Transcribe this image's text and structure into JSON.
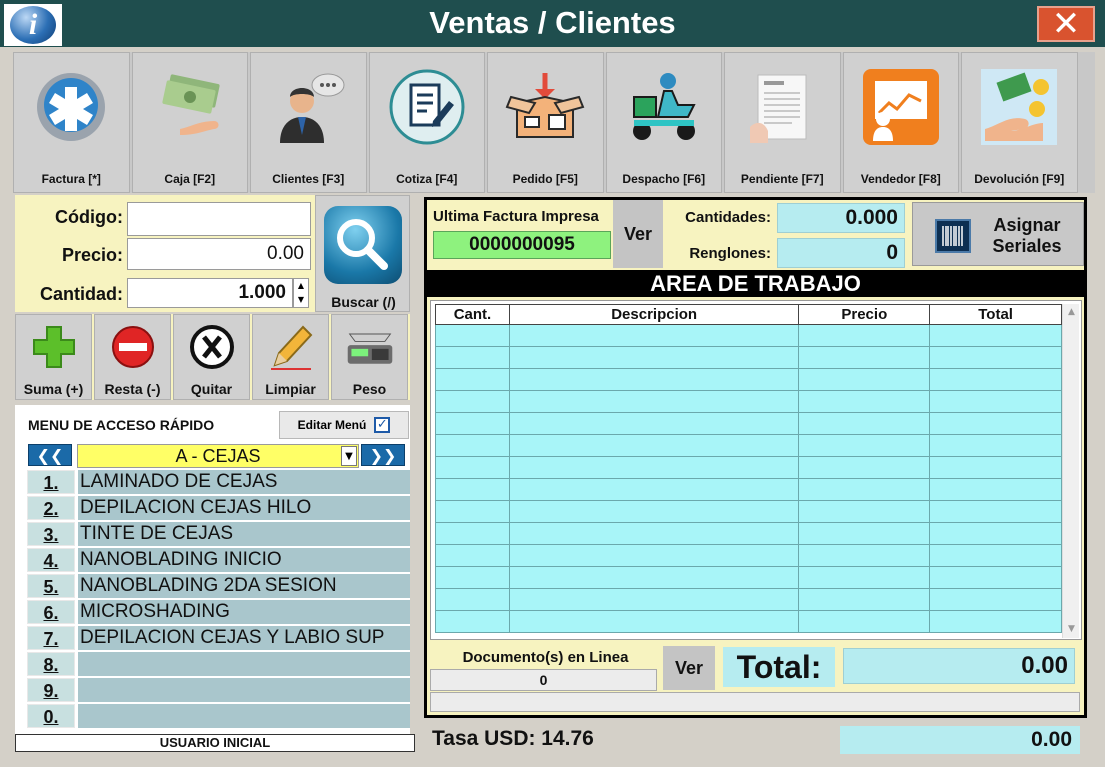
{
  "window": {
    "title": "Ventas / Clientes",
    "close_glyph": "✕",
    "logo_icon": "info-icon",
    "logo_glyph": "i"
  },
  "toolbar": [
    {
      "label": "Factura [*]",
      "icon": "medical-star-icon"
    },
    {
      "label": "Caja [F2]",
      "icon": "money-hand-icon"
    },
    {
      "label": "Clientes [F3]",
      "icon": "person-chat-icon"
    },
    {
      "label": "Cotiza [F4]",
      "icon": "document-edit-icon"
    },
    {
      "label": "Pedido [F5]",
      "icon": "package-icon"
    },
    {
      "label": "Despacho [F6]",
      "icon": "delivery-scooter-icon"
    },
    {
      "label": "Pendiente [F7]",
      "icon": "pending-document-icon"
    },
    {
      "label": "Vendedor [F8]",
      "icon": "sales-chart-icon"
    },
    {
      "label": "Devolución [F9]",
      "icon": "refund-coins-icon"
    }
  ],
  "inputs": {
    "codigo_label": "Código:",
    "codigo_value": "",
    "precio_label": "Precio:",
    "precio_value": "0.00",
    "cantidad_label": "Cantidad:",
    "cantidad_value": "1.000",
    "buscar_label": "Buscar (/)"
  },
  "actions": [
    {
      "label": "Suma (+)",
      "icon": "plus-icon"
    },
    {
      "label": "Resta (-)",
      "icon": "minus-icon"
    },
    {
      "label": "Quitar",
      "icon": "x-circle-icon"
    },
    {
      "label": "Limpiar",
      "icon": "pencil-icon"
    },
    {
      "label": "Peso",
      "icon": "scale-icon"
    }
  ],
  "quick_menu": {
    "title": "MENU DE ACCESO RÁPIDO",
    "edit_label": "Editar Menú",
    "edit_checked": true,
    "prev_glyph": "❮❮",
    "next_glyph": "❯❯",
    "category": "A - CEJAS",
    "items": [
      {
        "num": "1.",
        "label": "LAMINADO DE CEJAS"
      },
      {
        "num": "2.",
        "label": "DEPILACION CEJAS HILO"
      },
      {
        "num": "3.",
        "label": "TINTE DE CEJAS"
      },
      {
        "num": "4.",
        "label": "NANOBLADING INICIO"
      },
      {
        "num": "5.",
        "label": "NANOBLADING 2DA SESION"
      },
      {
        "num": "6.",
        "label": "MICROSHADING"
      },
      {
        "num": "7.",
        "label": "DEPILACION CEJAS Y LABIO SUP"
      },
      {
        "num": "8.",
        "label": ""
      },
      {
        "num": "9.",
        "label": ""
      },
      {
        "num": "0.",
        "label": ""
      }
    ]
  },
  "user": "USUARIO INICIAL",
  "invoice": {
    "label": "Ultima Factura Impresa",
    "number": "0000000095",
    "ver_label": "Ver"
  },
  "summary": {
    "cantidades_label": "Cantidades:",
    "cantidades_value": "0.000",
    "renglones_label": "Renglones:",
    "renglones_value": "0",
    "serial_label_1": "Asignar",
    "serial_label_2": "Seriales"
  },
  "work_area": {
    "title": "AREA DE TRABAJO",
    "columns": [
      "Cant.",
      "Descripcion",
      "Precio",
      "Total"
    ],
    "empty_rows": 14
  },
  "documents": {
    "label": "Documento(s) en Linea",
    "value": "0",
    "ver_label": "Ver"
  },
  "total": {
    "label": "Total:",
    "value": "0.00"
  },
  "footer": {
    "tasa_label": "Tasa USD: 14.76",
    "usd_total": "0.00"
  },
  "colors": {
    "titlebar": "#1f4e4e",
    "panel_yellow": "#f7f3c0",
    "grid_cyan": "#a8f5f8",
    "invoice_green": "#8ef27e",
    "close_red": "#d9532f"
  }
}
